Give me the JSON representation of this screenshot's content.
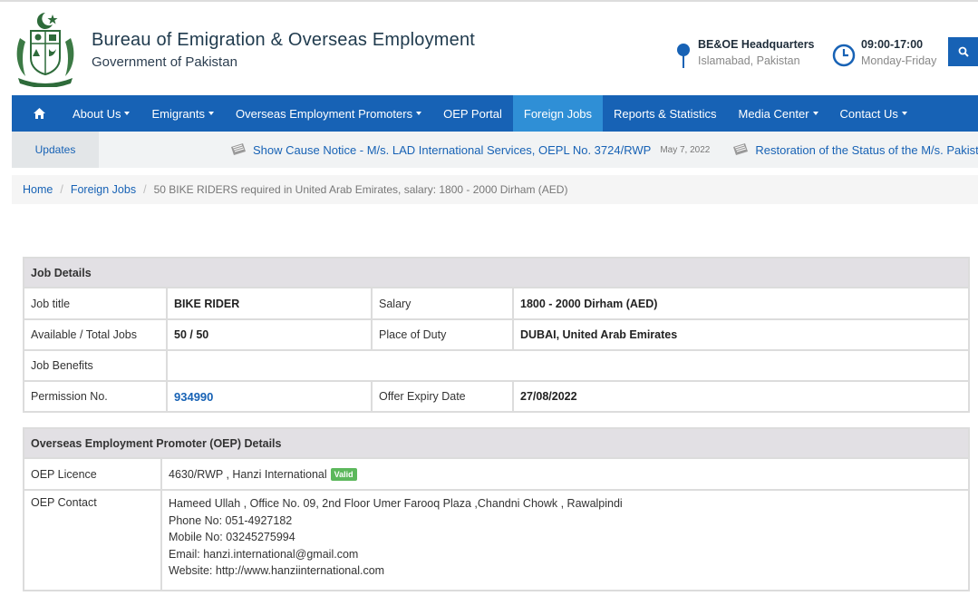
{
  "header": {
    "title": "Bureau of Emigration & Overseas Employment",
    "subtitle": "Government of Pakistan",
    "hq": {
      "title": "BE&OE Headquarters",
      "subtitle": "Islamabad, Pakistan",
      "icon": "map-pin-icon"
    },
    "hours": {
      "title": "09:00-17:00",
      "subtitle": "Monday-Friday",
      "icon": "clock-icon"
    },
    "search_icon": "search-icon",
    "accent": "#1762b5"
  },
  "nav": {
    "home_icon": "home-icon",
    "items": [
      {
        "label": "About Us",
        "dropdown": true
      },
      {
        "label": "Emigrants",
        "dropdown": true
      },
      {
        "label": "Overseas Employment Promoters",
        "dropdown": true
      },
      {
        "label": "OEP Portal",
        "dropdown": false
      },
      {
        "label": "Foreign Jobs",
        "dropdown": false,
        "active": true
      },
      {
        "label": "Reports & Statistics",
        "dropdown": false
      },
      {
        "label": "Media Center",
        "dropdown": true
      },
      {
        "label": "Contact Us",
        "dropdown": true
      }
    ]
  },
  "updates": {
    "label": "Updates",
    "items": [
      {
        "text": "Show Cause Notice - M/s. LAD International Services, OEPL No. 3724/RWP",
        "date": "May 7, 2022"
      },
      {
        "text": "Restoration of the Status of the M/s. Pakista",
        "date": ""
      }
    ]
  },
  "breadcrumb": {
    "home": "Home",
    "section": "Foreign Jobs",
    "current": "50 BIKE RIDERS required in United Arab Emirates, salary: 1800 - 2000 Dirham (AED)"
  },
  "job": {
    "heading": "Job Details",
    "title_label": "Job title",
    "title_value": "BIKE RIDER",
    "salary_label": "Salary",
    "salary_value": "1800 - 2000 Dirham (AED)",
    "jobs_label": "Available / Total Jobs",
    "jobs_value": "50 / 50",
    "place_label": "Place of Duty",
    "place_value": "DUBAI, United Arab Emirates",
    "benefits_label": "Job Benefits",
    "benefits_value": "",
    "permission_label": "Permission No.",
    "permission_value": "934990",
    "expiry_label": "Offer Expiry Date",
    "expiry_value": "27/08/2022"
  },
  "oep": {
    "heading": "Overseas Employment Promoter (OEP) Details",
    "licence_label": "OEP Licence",
    "licence_value": "4630/RWP , Hanzi International",
    "licence_badge": "Valid",
    "contact_label": "OEP Contact",
    "contact_lines": [
      "Hameed Ullah , Office No. 09, 2nd Floor Umer Farooq Plaza ,Chandni Chowk , Rawalpindi",
      "Phone No: 051-4927182",
      "Mobile No: 03245275994",
      "Email: hanzi.international@gmail.com",
      "Website: http://www.hanziinternational.com"
    ]
  }
}
